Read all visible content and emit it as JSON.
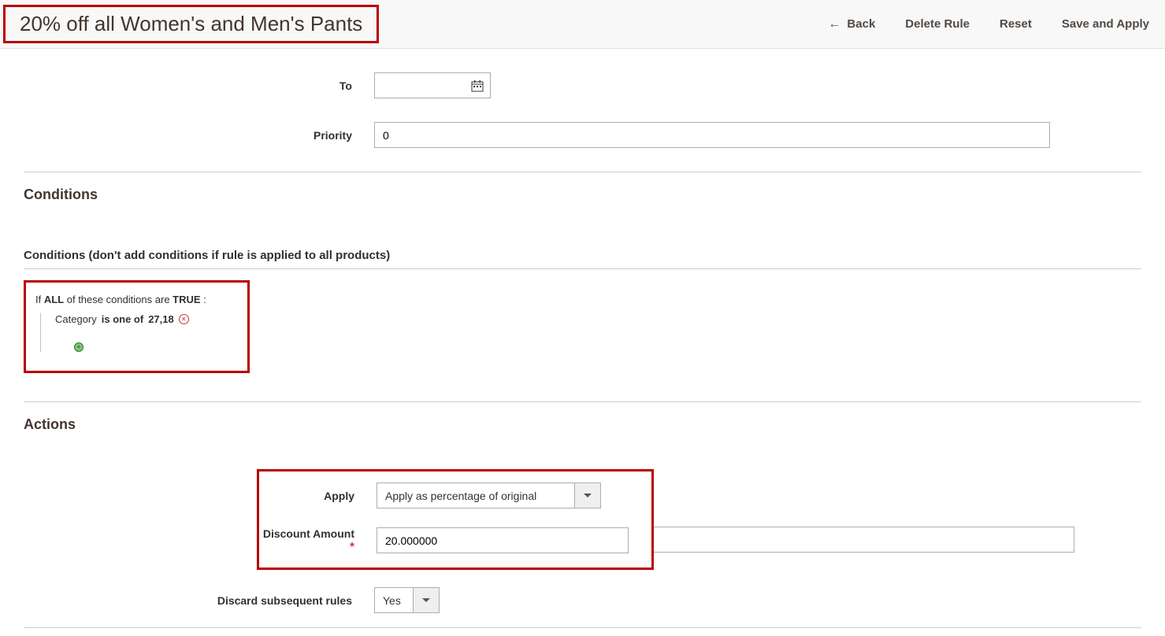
{
  "header": {
    "title": "20% off all Women's and Men's Pants",
    "back": "Back",
    "delete_rule": "Delete Rule",
    "reset": "Reset",
    "save_apply": "Save and Apply"
  },
  "form": {
    "to_label": "To",
    "to_value": "",
    "priority_label": "Priority",
    "priority_value": "0"
  },
  "conditions": {
    "heading": "Conditions",
    "sub_heading": "Conditions (don't add conditions if rule is applied to all products)",
    "if_text": "If ",
    "all": "ALL",
    "of_these": "  of these conditions are ",
    "true": "TRUE",
    "colon": " :",
    "attr": "Category",
    "op": "  is one of ",
    "val": " 27,18"
  },
  "actions": {
    "heading": "Actions",
    "apply_label": "Apply",
    "apply_value": "Apply as percentage of original",
    "discount_label": "Discount Amount",
    "discount_value": "20.000000",
    "discard_label": "Discard subsequent rules",
    "discard_value": "Yes"
  }
}
